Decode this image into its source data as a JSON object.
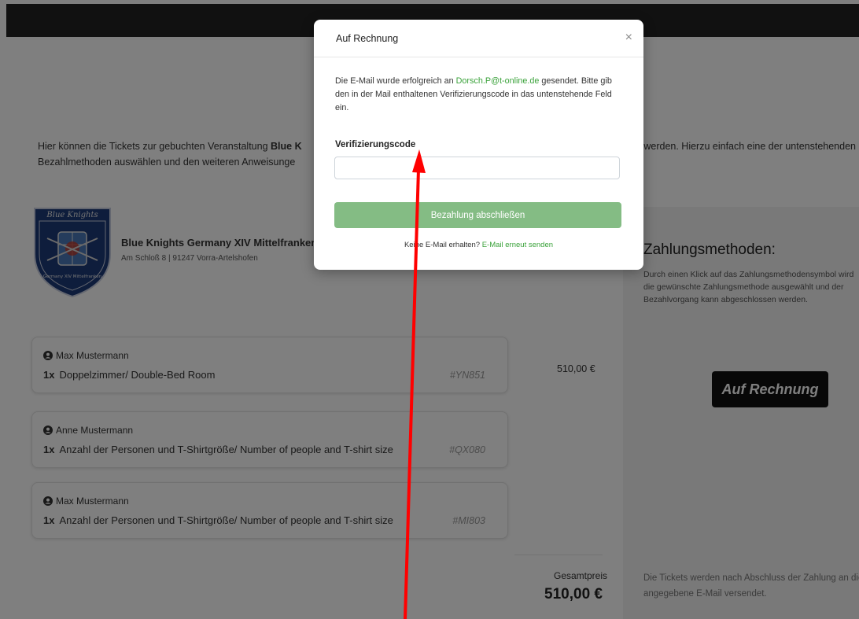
{
  "intro": {
    "text_before": "Hier können die Tickets zur gebuchten Veranstaltung ",
    "event_bold": "Blue K",
    "text_mid": "",
    "text_after": "zahlt werden. Hierzu einfach eine der untenstehenden",
    "line2": "Bezahlmethoden auswählen und den weiteren Anweisunge"
  },
  "organizer": {
    "logo_text_top": "Blue Knights",
    "logo_text_bottom": "Germany XIV Mittelfranken",
    "name": "Blue Knights Germany XIV Mittelfranken",
    "address": "Am Schloß 8 | 91247 Vorra-Artelshofen"
  },
  "tickets": [
    {
      "person": "Max Mustermann",
      "qty": "1x",
      "item": "Doppelzimmer/ Double-Bed Room",
      "code": "#YN851"
    },
    {
      "person": "Anne Mustermann",
      "qty": "1x",
      "item": "Anzahl der Personen und T-Shirtgröße/ Number of people and T-shirt size",
      "code": "#QX080"
    },
    {
      "person": "Max Mustermann",
      "qty": "1x",
      "item": "Anzahl der Personen und T-Shirtgröße/ Number of people and T-shirt size",
      "code": "#MI803"
    }
  ],
  "price": "510,00 €",
  "total": {
    "label": "Gesamtpreis",
    "value": "510,00 €"
  },
  "payment": {
    "title": "Zahlungsmethoden:",
    "description": "Durch einen Klick auf das Zahlungsmethodensymbol wird die gewünschte Zahlungsmethode ausgewählt und der Bezahlvorgang kann abgeschlossen werden.",
    "method_button": "Auf Rechnung",
    "footer": "Die Tickets werden nach Abschluss der Zahlung an die angegebene E-Mail versendet."
  },
  "modal": {
    "title": "Auf Rechnung",
    "close": "×",
    "text_before": "Die E-Mail wurde erfolgreich an ",
    "email": "Dorsch.P@t-online.de",
    "text_after": " gesendet. Bitte gib den in der Mail enthaltenen Verifizierungscode in das untenstehende Feld ein.",
    "code_label": "Verifizierungscode",
    "code_value": "",
    "submit": "Bezahlung abschließen",
    "resend_text": "Keine E-Mail erhalten? ",
    "resend_link": "E-Mail erneut senden"
  },
  "colors": {
    "accent_green": "#3aa23a",
    "button_green": "#84bc84",
    "annotation_arrow": "#ff0000"
  }
}
